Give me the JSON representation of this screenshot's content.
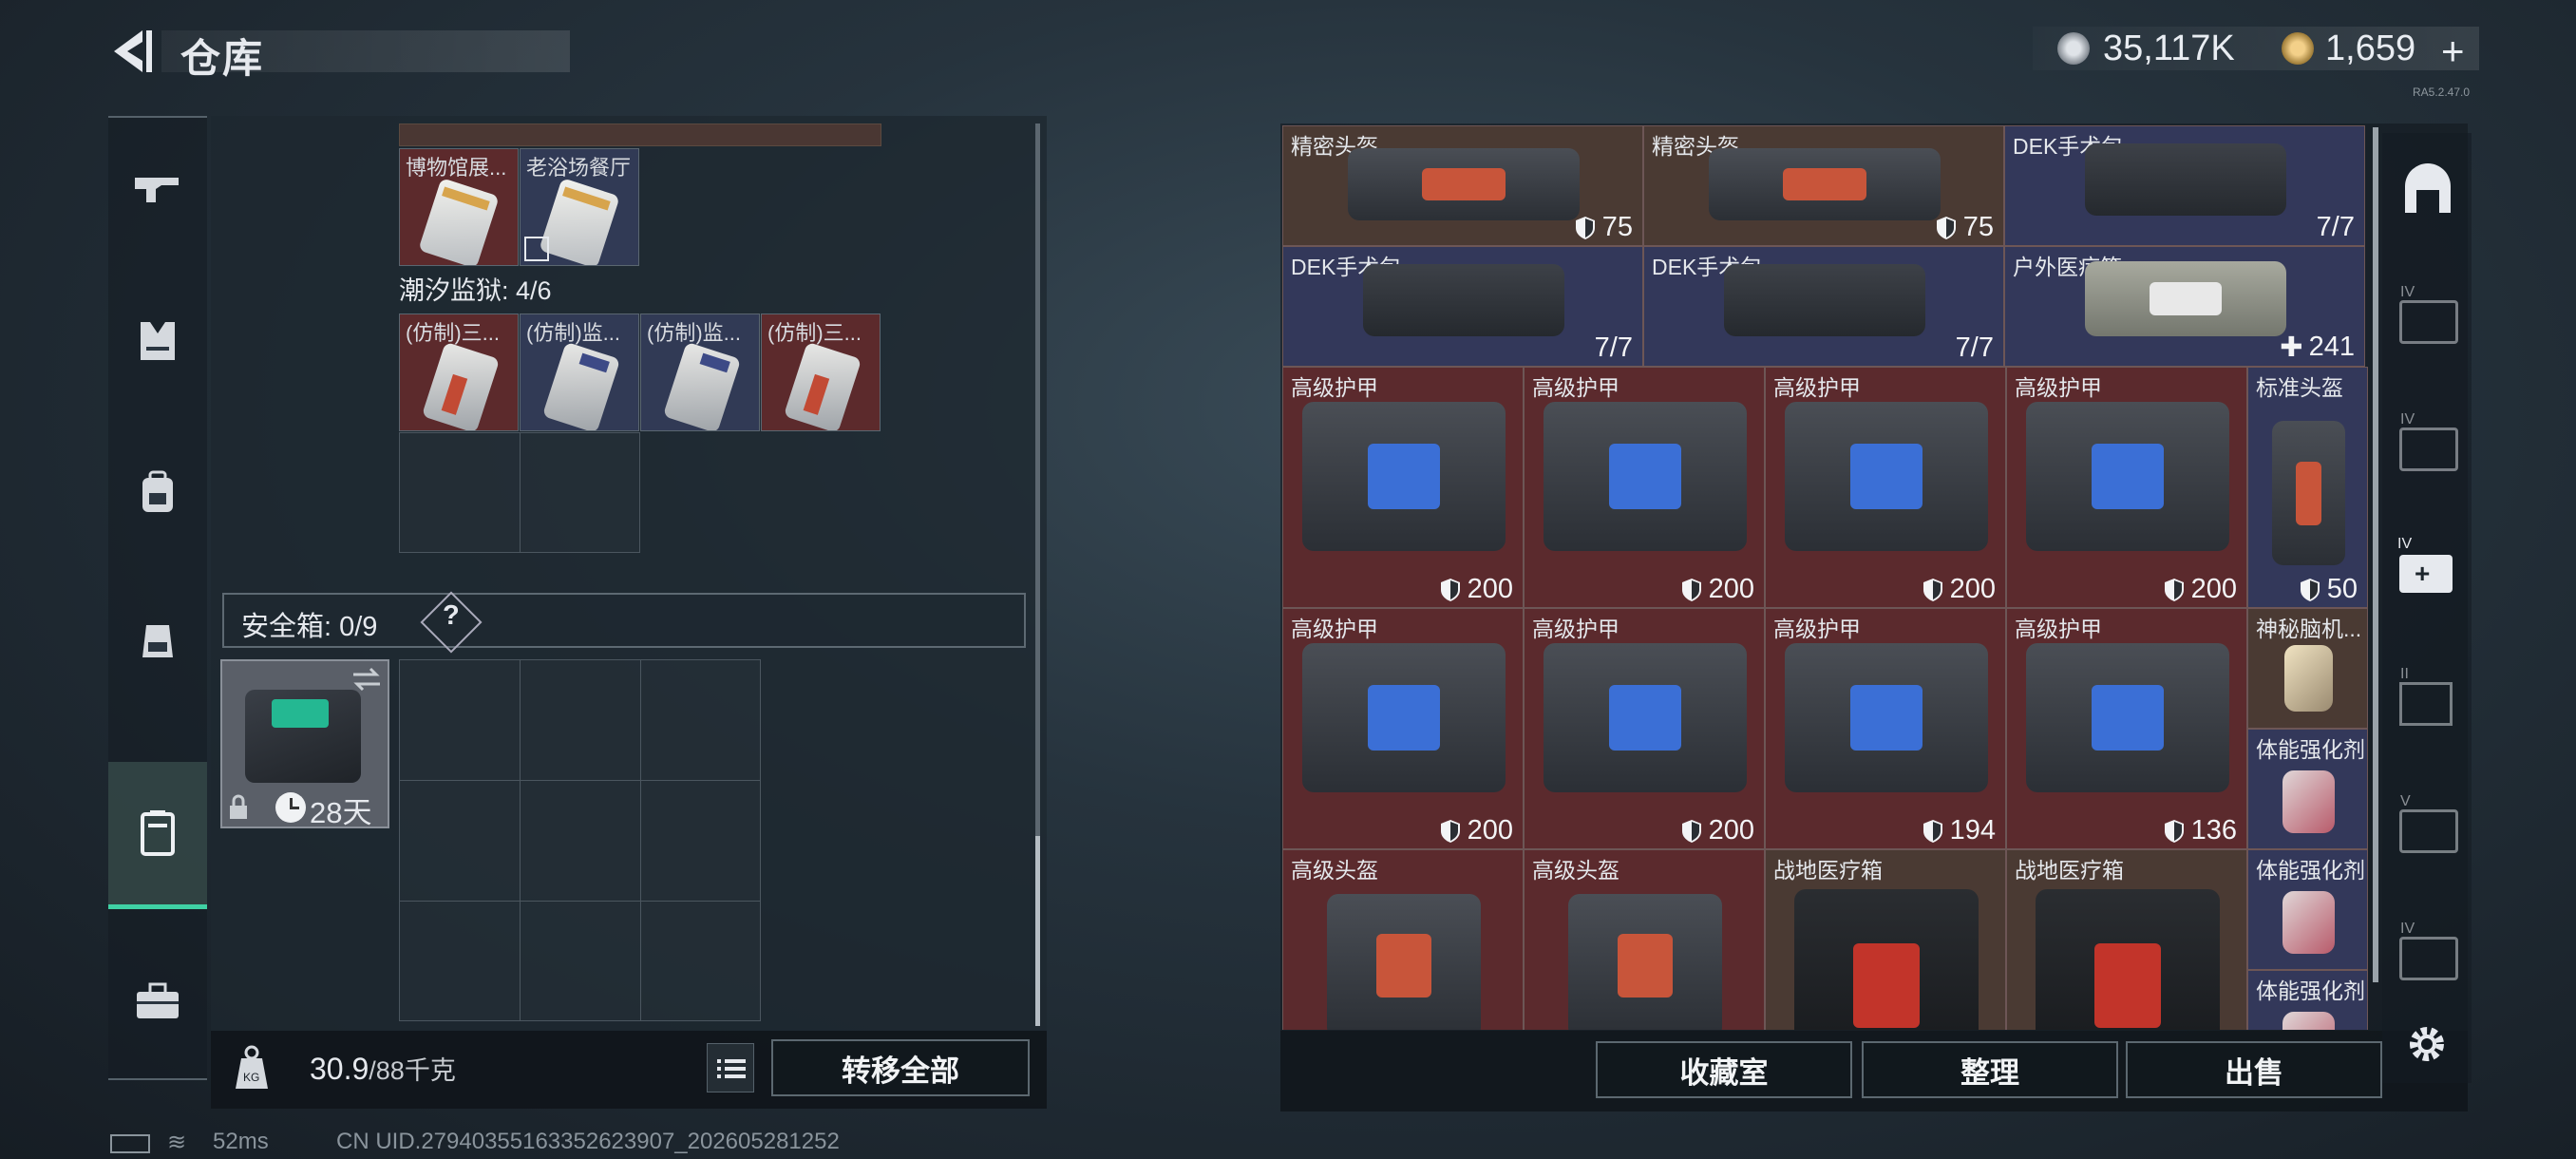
{
  "header": {
    "title": "仓库",
    "currency": [
      {
        "icon": "silver-coin-icon",
        "value": "35,117K"
      },
      {
        "icon": "gold-coin-icon",
        "value": "1,659"
      }
    ],
    "add_label": "+",
    "version": "RA5.2.47.0"
  },
  "left_nav": [
    {
      "icon": "gun-icon"
    },
    {
      "icon": "armor-vest-icon"
    },
    {
      "icon": "backpack-icon"
    },
    {
      "icon": "chest-rig-icon"
    },
    {
      "icon": "secure-case-icon",
      "active": true
    },
    {
      "icon": "toolbox-icon"
    }
  ],
  "left_panel": {
    "top_items": [
      {
        "name": "博物馆展...",
        "bg": "red"
      },
      {
        "name": "老浴场餐厅",
        "bg": "blue"
      }
    ],
    "zone": {
      "label": "潮汐监狱: 4/6"
    },
    "zone_items": [
      {
        "name": "(仿制)三...",
        "bg": "red"
      },
      {
        "name": "(仿制)监...",
        "bg": "blue"
      },
      {
        "name": "(仿制)监...",
        "bg": "blue"
      },
      {
        "name": "(仿制)三...",
        "bg": "red"
      }
    ],
    "safebox": {
      "label": "安全箱: 0/9",
      "help": "?",
      "days": "28天"
    }
  },
  "bottom_left": {
    "weight_current": "30.9",
    "weight_max": "/88千克",
    "transfer_all": "转移全部"
  },
  "storage_items": [
    {
      "name": "精密头盔",
      "value": "75",
      "icon": "shield-icon",
      "bg": "brown"
    },
    {
      "name": "精密头盔",
      "value": "75",
      "icon": "shield-icon",
      "bg": "brown"
    },
    {
      "name": "DEK手术包",
      "value": "7/7",
      "icon": "",
      "bg": "navy"
    },
    {
      "name": "DEK手术包",
      "value": "7/7",
      "icon": "",
      "bg": "navy"
    },
    {
      "name": "DEK手术包",
      "value": "7/7",
      "icon": "",
      "bg": "navy"
    },
    {
      "name": "户外医疗箱",
      "value": "241",
      "icon": "plus-icon",
      "bg": "navy"
    },
    {
      "name": "高级护甲",
      "value": "200",
      "icon": "shield-icon",
      "bg": "red"
    },
    {
      "name": "高级护甲",
      "value": "200",
      "icon": "shield-icon",
      "bg": "red"
    },
    {
      "name": "高级护甲",
      "value": "200",
      "icon": "shield-icon",
      "bg": "red"
    },
    {
      "name": "高级护甲",
      "value": "200",
      "icon": "shield-icon",
      "bg": "red"
    },
    {
      "name": "标准头盔",
      "value": "50",
      "icon": "shield-icon",
      "bg": "navy"
    },
    {
      "name": "高级护甲",
      "value": "200",
      "icon": "shield-icon",
      "bg": "red"
    },
    {
      "name": "高级护甲",
      "value": "200",
      "icon": "shield-icon",
      "bg": "red"
    },
    {
      "name": "高级护甲",
      "value": "194",
      "icon": "shield-icon",
      "bg": "red"
    },
    {
      "name": "高级护甲",
      "value": "136",
      "icon": "shield-icon",
      "bg": "red"
    },
    {
      "name": "神秘脑机...",
      "value": "",
      "icon": "",
      "bg": "brown"
    },
    {
      "name": "体能强化剂",
      "value": "",
      "icon": "",
      "bg": "navy"
    },
    {
      "name": "高级头盔",
      "value": "",
      "icon": "",
      "bg": "red"
    },
    {
      "name": "高级头盔",
      "value": "",
      "icon": "",
      "bg": "red"
    },
    {
      "name": "战地医疗箱",
      "value": "",
      "icon": "",
      "bg": "brown"
    },
    {
      "name": "战地医疗箱",
      "value": "",
      "icon": "",
      "bg": "brown"
    },
    {
      "name": "体能强化剂",
      "value": "",
      "icon": "",
      "bg": "navy"
    },
    {
      "name": "体能强化剂",
      "value": "",
      "icon": "",
      "bg": "navy"
    }
  ],
  "bottom_right": {
    "collection": "收藏室",
    "organize": "整理",
    "sell": "出售"
  },
  "right_nav": [
    {
      "icon": "gate-icon"
    },
    {
      "icon": "tier-iv-case-icon",
      "label": "IV"
    },
    {
      "icon": "tier-iv-case-icon",
      "label": "IV"
    },
    {
      "icon": "tier-iv-medkit-icon",
      "label": "IV"
    },
    {
      "icon": "tier-ii-storage-icon",
      "label": "II"
    },
    {
      "icon": "tier-v-case-icon",
      "label": "V"
    },
    {
      "icon": "tier-iv-case-icon",
      "label": "IV"
    },
    {
      "icon": "settings-gear-icon"
    }
  ],
  "status": {
    "ping": "52ms",
    "uid": "CN UID.27940355163352623907_202605281252"
  }
}
